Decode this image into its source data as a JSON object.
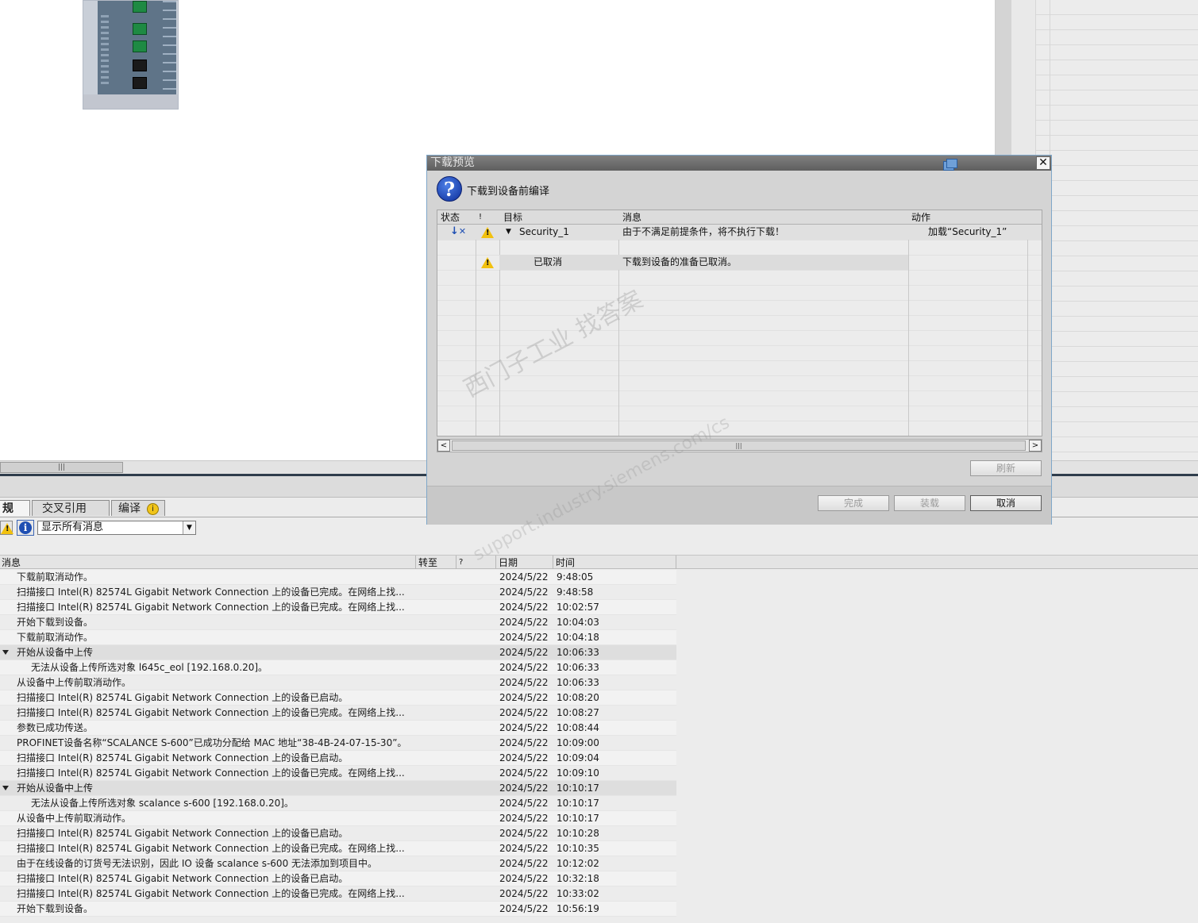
{
  "dialog": {
    "title": "下载预览",
    "heading": "下载到设备前编译",
    "columns": {
      "status": "状态",
      "flag": "!",
      "target": "目标",
      "message": "消息",
      "action": "动作"
    },
    "rows": [
      {
        "target": "Security_1",
        "message": "由于不满足前提条件，将不执行下载！",
        "action": "加载“Security_1”"
      },
      {
        "target": "已取消",
        "message": "下载到设备的准备已取消。",
        "action": ""
      }
    ],
    "buttons": {
      "refresh": "刷新",
      "finish": "完成",
      "load": "装载",
      "cancel": "取消"
    },
    "close": "✕"
  },
  "watermark": {
    "line1": "西门子工业  找答案",
    "line2": "support.industry.siemens.com/cs"
  },
  "inspector": {
    "tabs": {
      "general": "规",
      "xref": "交叉引用",
      "compile": "编译"
    },
    "filter": {
      "value": "显示所有消息"
    },
    "columns": {
      "message": "消息",
      "goto": "转至",
      "help": "?",
      "date": "日期",
      "time": "时间"
    },
    "messages": [
      {
        "text": "下载前取消动作。",
        "date": "2024/5/22",
        "time": "9:48:05",
        "kind": "normal"
      },
      {
        "text": "扫描接口 Intel(R) 82574L Gigabit Network Connection 上的设备已完成。在网络上找...",
        "date": "2024/5/22",
        "time": "9:48:58",
        "kind": "normal"
      },
      {
        "text": "扫描接口 Intel(R) 82574L Gigabit Network Connection 上的设备已完成。在网络上找...",
        "date": "2024/5/22",
        "time": "10:02:57",
        "kind": "normal"
      },
      {
        "text": "开始下载到设备。",
        "date": "2024/5/22",
        "time": "10:04:03",
        "kind": "normal"
      },
      {
        "text": "下载前取消动作。",
        "date": "2024/5/22",
        "time": "10:04:18",
        "kind": "normal"
      },
      {
        "text": "开始从设备中上传",
        "date": "2024/5/22",
        "time": "10:06:33",
        "kind": "group"
      },
      {
        "text": "无法从设备上传所选对象 l645c_eol [192.168.0.20]。",
        "date": "2024/5/22",
        "time": "10:06:33",
        "kind": "child"
      },
      {
        "text": "从设备中上传前取消动作。",
        "date": "2024/5/22",
        "time": "10:06:33",
        "kind": "normal"
      },
      {
        "text": "扫描接口 Intel(R) 82574L Gigabit Network Connection 上的设备已启动。",
        "date": "2024/5/22",
        "time": "10:08:20",
        "kind": "normal"
      },
      {
        "text": "扫描接口 Intel(R) 82574L Gigabit Network Connection 上的设备已完成。在网络上找...",
        "date": "2024/5/22",
        "time": "10:08:27",
        "kind": "normal"
      },
      {
        "text": "参数已成功传送。",
        "date": "2024/5/22",
        "time": "10:08:44",
        "kind": "normal"
      },
      {
        "text": "PROFINET设备名称“SCALANCE S-600”已成功分配给 MAC 地址“38-4B-24-07-15-30”。",
        "date": "2024/5/22",
        "time": "10:09:00",
        "kind": "normal"
      },
      {
        "text": "扫描接口 Intel(R) 82574L Gigabit Network Connection 上的设备已启动。",
        "date": "2024/5/22",
        "time": "10:09:04",
        "kind": "normal"
      },
      {
        "text": "扫描接口 Intel(R) 82574L Gigabit Network Connection 上的设备已完成。在网络上找...",
        "date": "2024/5/22",
        "time": "10:09:10",
        "kind": "normal"
      },
      {
        "text": "开始从设备中上传",
        "date": "2024/5/22",
        "time": "10:10:17",
        "kind": "group"
      },
      {
        "text": "无法从设备上传所选对象 scalance s-600 [192.168.0.20]。",
        "date": "2024/5/22",
        "time": "10:10:17",
        "kind": "child"
      },
      {
        "text": "从设备中上传前取消动作。",
        "date": "2024/5/22",
        "time": "10:10:17",
        "kind": "normal"
      },
      {
        "text": "扫描接口 Intel(R) 82574L Gigabit Network Connection 上的设备已启动。",
        "date": "2024/5/22",
        "time": "10:10:28",
        "kind": "normal"
      },
      {
        "text": "扫描接口 Intel(R) 82574L Gigabit Network Connection 上的设备已完成。在网络上找...",
        "date": "2024/5/22",
        "time": "10:10:35",
        "kind": "normal"
      },
      {
        "text": "由于在线设备的订货号无法识别，因此 IO 设备 scalance s-600 无法添加到项目中。",
        "date": "2024/5/22",
        "time": "10:12:02",
        "kind": "normal"
      },
      {
        "text": "扫描接口 Intel(R) 82574L Gigabit Network Connection 上的设备已启动。",
        "date": "2024/5/22",
        "time": "10:32:18",
        "kind": "normal"
      },
      {
        "text": "扫描接口 Intel(R) 82574L Gigabit Network Connection 上的设备已完成。在网络上找...",
        "date": "2024/5/22",
        "time": "10:33:02",
        "kind": "normal"
      },
      {
        "text": "开始下载到设备。",
        "date": "2024/5/22",
        "time": "10:56:19",
        "kind": "normal"
      }
    ]
  }
}
